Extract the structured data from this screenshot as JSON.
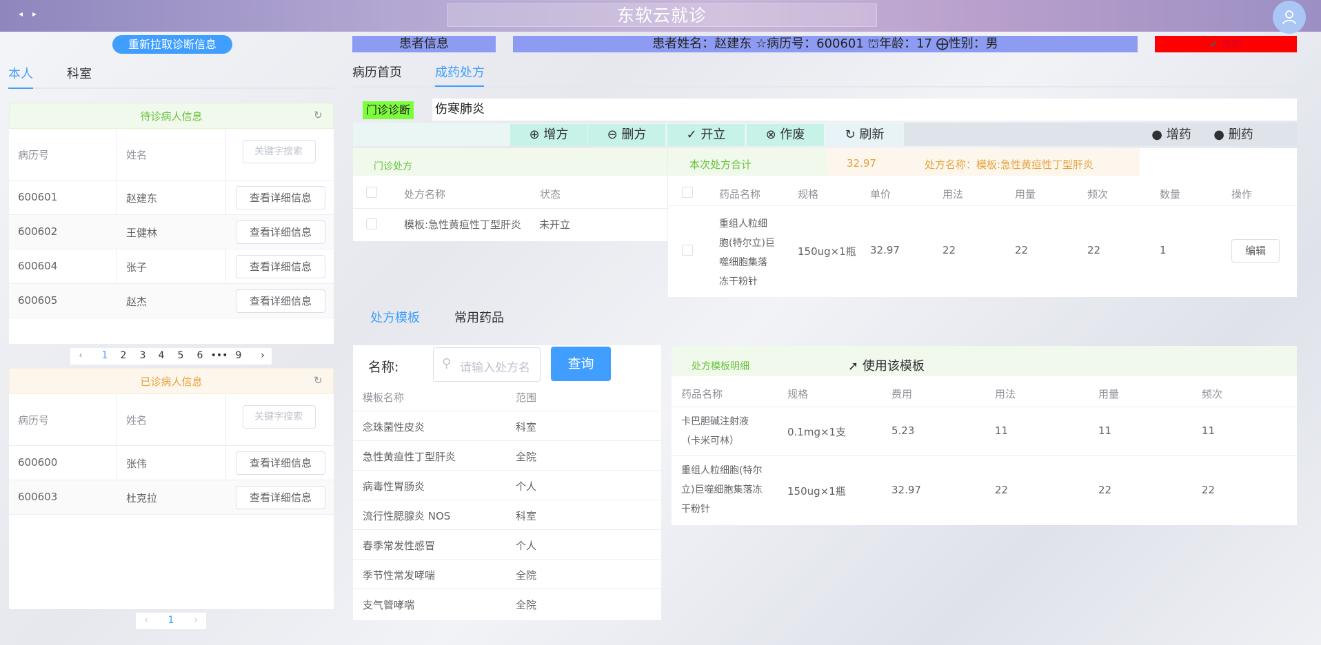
{
  "app": {
    "title": "东软云就诊"
  },
  "header": {
    "refresh_diag": "重新拉取诊断信息",
    "patient_info_label": "患者信息",
    "patient_bar": "患者姓名：赵建东 ☆病历号：600601 ⛫年龄：17 ⨁性别：男",
    "finish": "诊毕",
    "colors": {
      "info": "#8d9cf2",
      "finish": "#ff0000",
      "primary": "#409eff"
    }
  },
  "left_tabs": [
    "本人",
    "科室"
  ],
  "waiting": {
    "title": "待诊病人信息",
    "headers": [
      "病历号",
      "姓名"
    ],
    "keyword_placeholder": "关键字搜索",
    "rows": [
      {
        "id": "600601",
        "name": "赵建东",
        "action": "查看详细信息"
      },
      {
        "id": "600602",
        "name": "王健林",
        "action": "查看详细信息"
      },
      {
        "id": "600604",
        "name": "张子",
        "action": "查看详细信息"
      },
      {
        "id": "600605",
        "name": "赵杰",
        "action": "查看详细信息"
      }
    ],
    "pager": [
      "1",
      "2",
      "3",
      "4",
      "5",
      "6",
      "•••",
      "9"
    ]
  },
  "done": {
    "title": "已诊病人信息",
    "headers": [
      "病历号",
      "姓名"
    ],
    "keyword_placeholder": "关键字搜索",
    "rows": [
      {
        "id": "600600",
        "name": "张伟",
        "action": "查看详细信息"
      },
      {
        "id": "600603",
        "name": "杜克拉",
        "action": "查看详细信息"
      }
    ],
    "pager": [
      "1"
    ]
  },
  "main_tabs": [
    "病历首页",
    "成药处方"
  ],
  "diagnosis": {
    "label": "门诊诊断",
    "value": "伤寒肺炎"
  },
  "actions": {
    "add": "增方",
    "delete": "删方",
    "open": "开立",
    "void": "作废",
    "refresh": "刷新",
    "add_drug": "增药",
    "delete_drug": "删药"
  },
  "prescriptions": {
    "title": "门诊处方",
    "headers": [
      "处方名称",
      "状态"
    ],
    "rows": [
      {
        "name": "模板:急性黄疸性丁型肝炎",
        "status": "未开立"
      }
    ]
  },
  "current": {
    "total_label": "本次处方合计",
    "total_value": "32.97",
    "name_label": "处方名称：模板:急性黄疸性丁型肝炎",
    "headers": [
      "药品名称",
      "规格",
      "单价",
      "用法",
      "用量",
      "频次",
      "数量",
      "操作"
    ],
    "rows": [
      {
        "name_lines": [
          "重组人粒细",
          "胞(特尔立)巨",
          "噬细胞集落",
          "冻干粉针"
        ],
        "spec": "150ug×1瓶",
        "price": "32.97",
        "usage": "22",
        "dose": "22",
        "freq": "22",
        "qty": "1",
        "op": "编辑"
      }
    ]
  },
  "bottom_tabs": [
    "处方模板",
    "常用药品"
  ],
  "template_search": {
    "label": "名称:",
    "placeholder": "请输入处方名",
    "button": "查询",
    "headers": [
      "模板名称",
      "范围"
    ],
    "rows": [
      {
        "name": "念珠菌性皮炎",
        "scope": "科室"
      },
      {
        "name": "急性黄疸性丁型肝炎",
        "scope": "全院"
      },
      {
        "name": "病毒性胃肠炎",
        "scope": "个人"
      },
      {
        "name": "流行性腮腺炎 NOS",
        "scope": "科室"
      },
      {
        "name": "春季常发性感冒",
        "scope": "个人"
      },
      {
        "name": "季节性常发哮喘",
        "scope": "全院"
      },
      {
        "name": "支气管哮喘",
        "scope": "全院"
      }
    ]
  },
  "template_detail": {
    "title": "处方模板明细",
    "use": "使用该模板",
    "headers": [
      "药品名称",
      "规格",
      "费用",
      "用法",
      "用量",
      "频次"
    ],
    "rows": [
      {
        "name_lines": [
          "卡巴胆碱注射液",
          "（卡米可林）"
        ],
        "spec": "0.1mg×1支",
        "fee": "5.23",
        "usage": "11",
        "dose": "11",
        "freq": "11"
      },
      {
        "name_lines": [
          "重组人粒细胞(特尔",
          "立)巨噬细胞集落冻",
          "干粉针"
        ],
        "spec": "150ug×1瓶",
        "fee": "32.97",
        "usage": "22",
        "dose": "22",
        "freq": "22"
      }
    ]
  }
}
